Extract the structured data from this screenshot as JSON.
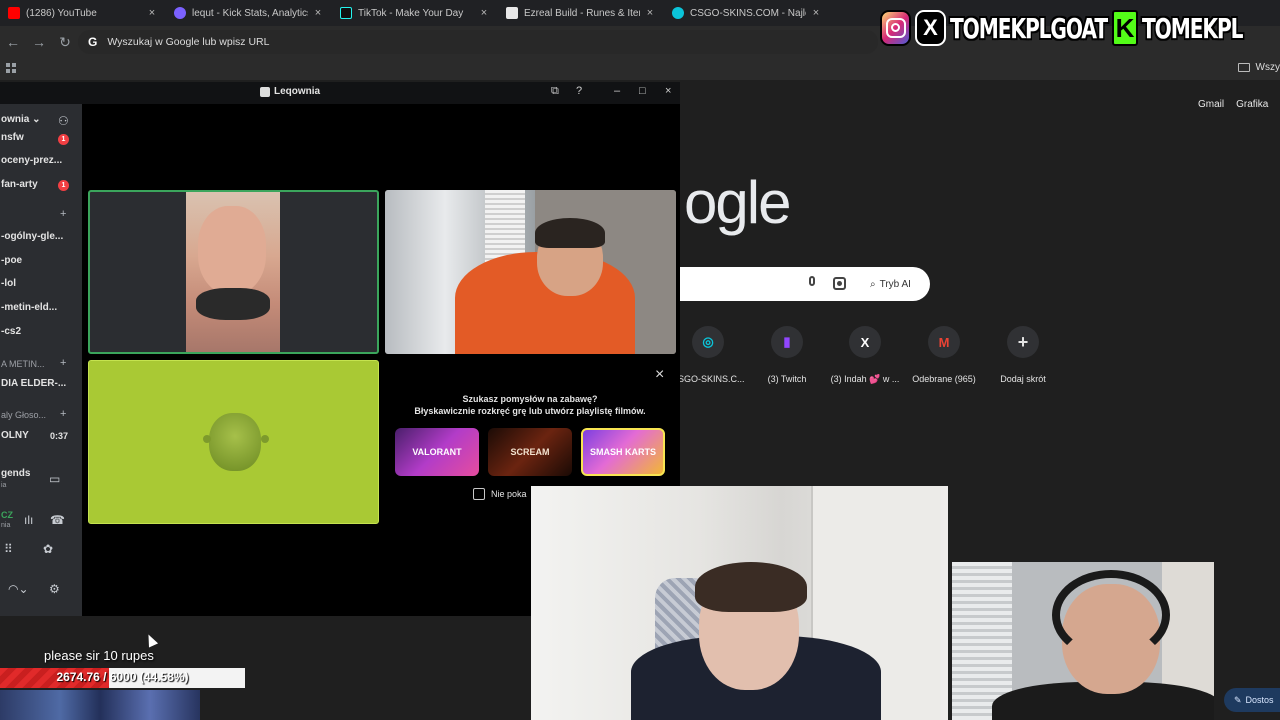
{
  "browser": {
    "tabs": [
      {
        "label": "(1286) YouTube",
        "favicon_color": "#ff0000"
      },
      {
        "label": "lequt - Kick Stats, Analytics and",
        "favicon_color": "#7b61ff"
      },
      {
        "label": "TikTok - Make Your Day",
        "favicon_color": "#111111"
      },
      {
        "label": "Ezreal Build - Runes & Items Pa",
        "favicon_color": "#e8e8e8"
      },
      {
        "label": "CSGO-SKINS.COM - Najlepsze",
        "favicon_color": "#0bc4d9"
      }
    ],
    "close_glyph": "×",
    "omnibox_placeholder": "Wyszukaj w Google lub wpisz URL",
    "omnibox_g": "G",
    "bookmarks_right": "Wszy"
  },
  "overlay": {
    "instagram_handle": "TOMEKPLGOAT",
    "kick_handle": "TOMEKPL",
    "kick_letter": "K",
    "x_letter": "X"
  },
  "google": {
    "top_links": [
      "Gmail",
      "Grafika"
    ],
    "logo_text": "ogle",
    "ai_button": "Tryb AI",
    "shortcuts": [
      {
        "label": "CSGO-SKINS.C...",
        "glyph": "◎",
        "color": "#0bc4d9"
      },
      {
        "label": "(3) Twitch",
        "glyph": "▮",
        "color": "#9146ff"
      },
      {
        "label": "(3) Indah 💕 w ...",
        "glyph": "X",
        "color": "#ffffff"
      },
      {
        "label": "Odebrane (965)",
        "glyph": "M",
        "color": "#ea4335"
      },
      {
        "label": "Dodaj skrót",
        "glyph": "+",
        "color": "#e3e3e3"
      }
    ]
  },
  "discord": {
    "window_title": "Leqownia",
    "server_name": "ownia",
    "channels": [
      {
        "name": "nsfw",
        "badge": "1"
      },
      {
        "name": "oceny-prez...",
        "badge": ""
      },
      {
        "name": "fan-arty",
        "badge": "1"
      },
      {
        "name": "-ogólny-gle...",
        "badge": ""
      },
      {
        "name": "-poe",
        "badge": ""
      },
      {
        "name": "-lol",
        "badge": ""
      },
      {
        "name": "-metin-eld...",
        "badge": ""
      },
      {
        "name": "-cs2",
        "badge": ""
      },
      {
        "name": "A METIN...",
        "badge": ""
      },
      {
        "name": "DIA ELDER-...",
        "badge": ""
      },
      {
        "name": "aly Głoso...",
        "badge": ""
      },
      {
        "name": "OLNY",
        "badge": ""
      }
    ],
    "call_time": "0:37",
    "voice_status_1": "gends",
    "voice_status_1_sub": "ia",
    "voice_status_2": "CZ",
    "voice_status_2_sub": "nia",
    "activity": {
      "prompt_line1": "Szukasz pomysłów na zabawę?",
      "prompt_line2": "Błyskawicznie rozkręć grę lub utwórz playlistę filmów.",
      "games": [
        "VALORANT",
        "SCREAM",
        "SMASH KARTS"
      ],
      "dont_show_label": "Nie poka"
    }
  },
  "webcam": {
    "edit_button": "Dostos"
  },
  "donation_goal": {
    "title": "please sir 10 rupes",
    "progress_text": "2674.76 / 6000 (44.58%)",
    "current": 2674.76,
    "target": 6000,
    "percent": 44.58
  }
}
